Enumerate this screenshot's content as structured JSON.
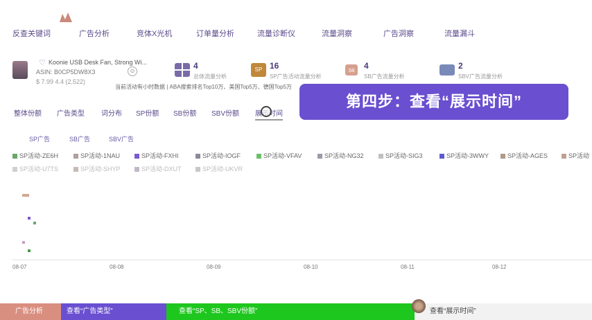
{
  "nav": [
    "反查关键词",
    "广告分析",
    "竞体X光机",
    "订单量分析",
    "流量诊断仪",
    "流量洞察",
    "广告洞察",
    "流量漏斗"
  ],
  "product": {
    "name": "Koonie USB Desk Fan, Strong Wi...",
    "asin": "ASIN: B0CP5DW8X3",
    "price": "$ 7.99  4.4 (2,522)"
  },
  "stats": [
    {
      "value": "4",
      "label": "总体流量分析",
      "color": "#7a6aa8",
      "icon": "grid-icon"
    },
    {
      "value": "16",
      "label": "SP广告活动流量分析",
      "color": "#c0883a",
      "icon": "sp-icon"
    },
    {
      "value": "4",
      "label": "SB广告流量分析",
      "color": "#d6a08f",
      "icon": "sb-icon"
    },
    {
      "value": "2",
      "label": "SBV广告流量分析",
      "color": "#7a8ab8",
      "icon": "sbv-icon"
    }
  ],
  "notice": "当前活动有小时数据 | ABA搜索排名Top10万、美国Top5万、德国Top5万",
  "step_banner": "第四步：查看“展示时间”",
  "tabs": [
    "整体份额",
    "广告类型",
    "词分布",
    "SP份额",
    "SB份额",
    "SBV份额",
    "展示时间"
  ],
  "subtabs": [
    "SP广告",
    "SB广告",
    "SBV广告"
  ],
  "legend1": [
    {
      "label": "SP活动-ZE6H",
      "color": "#6aa86a"
    },
    {
      "label": "SP活动-1NAU",
      "color": "#b0a0a0"
    },
    {
      "label": "SP活动-FXHI",
      "color": "#7a5ad0"
    },
    {
      "label": "SP活动-IOGF",
      "color": "#8a8a9a"
    },
    {
      "label": "SP活动-VFAV",
      "color": "#6ac06a"
    },
    {
      "label": "SP活动-NG32",
      "color": "#9a9aa8"
    },
    {
      "label": "SP活动-SIG3",
      "color": "#c0c0c0"
    },
    {
      "label": "SP活动-3WWY",
      "color": "#5a5ad0"
    },
    {
      "label": "SP活动-AGES",
      "color": "#b09a8a"
    },
    {
      "label": "SP活动",
      "color": "#c0a090"
    }
  ],
  "legend2": [
    {
      "label": "SP活动-U7TS",
      "color": "#d0d0d0"
    },
    {
      "label": "SP活动-SHYP",
      "color": "#c8b8b8"
    },
    {
      "label": "SP活动-DXUT",
      "color": "#c0b8c8"
    },
    {
      "label": "SP活动-UKVR",
      "color": "#c8c8c8"
    }
  ],
  "chart_data": {
    "type": "scatter",
    "x_ticks": [
      "08-07",
      "08-08",
      "08-09",
      "08-10",
      "08-11",
      "08-12"
    ],
    "marks": [
      {
        "series": "SP活动-1NAU",
        "x": "08-07",
        "level": 0.88,
        "color": "#d0a890"
      },
      {
        "series": "SP活动-FXHI",
        "x": "08-07",
        "level": 0.55,
        "color": "#7a5ad0"
      },
      {
        "series": "SP活动-ZE6H",
        "x": "08-07",
        "level": 0.48,
        "color": "#6aa86a"
      },
      {
        "series": "SP活动-FXHI",
        "x": "08-07",
        "level": 0.2,
        "color": "#c8a0c8"
      },
      {
        "series": "SP活动-ZE6H",
        "x": "08-07",
        "level": 0.08,
        "color": "#4a9a4a"
      }
    ]
  },
  "bottom": {
    "seg1": "广告分析",
    "seg2": "查看“广告类型”",
    "seg3": "查看“SP、SB、SBV份额”",
    "seg4": "查看“展示时间”"
  }
}
